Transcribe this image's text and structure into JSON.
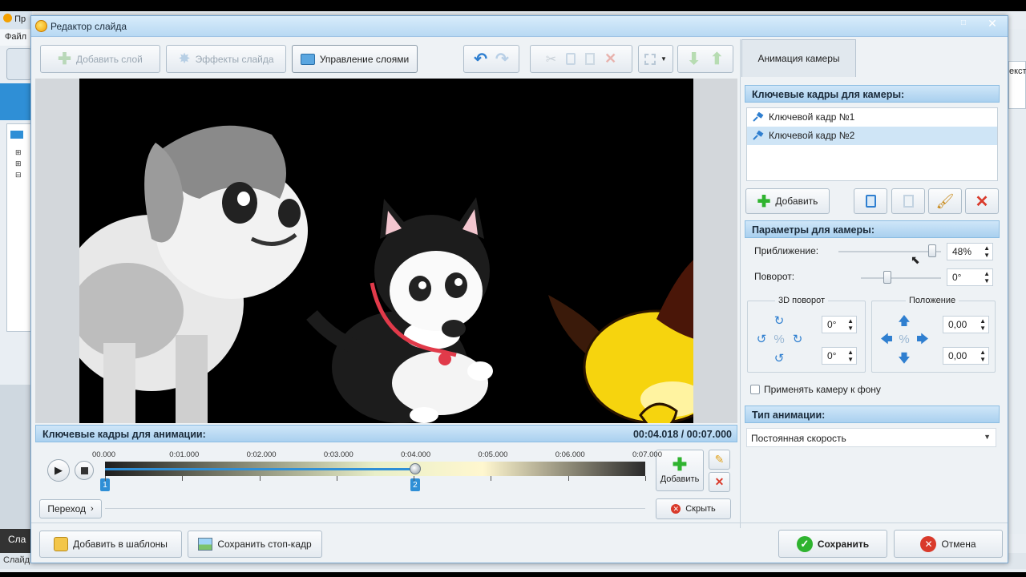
{
  "background_app": {
    "title_fragment": "Пр",
    "menu_fragment": "Файл",
    "left_bottom_fragment": "Сла",
    "status_fragment": "Слайд",
    "right_fragment": "екста"
  },
  "dialog": {
    "title": "Редактор слайда"
  },
  "toolbar": {
    "add_layer": "Добавить слой",
    "slide_effects": "Эффекты слайда",
    "manage_layers": "Управление слоями"
  },
  "timeline": {
    "header": "Ключевые кадры для анимации:",
    "time_display": "00:04.018 / 00:07.000",
    "ticks": [
      "00.000",
      "0:01.000",
      "0:02.000",
      "0:03.000",
      "0:04.000",
      "0:05.000",
      "0:06.000",
      "0:07.000"
    ],
    "markers": [
      "1",
      "2"
    ],
    "current_position_fraction": 0.574,
    "add_label": "Добавить",
    "transition_label": "Переход",
    "hide_label": "Скрыть"
  },
  "right_panel": {
    "tab": "Анимация камеры",
    "keyframes_header": "Ключевые кадры для камеры:",
    "keyframes": [
      {
        "label": "Ключевой кадр №1",
        "selected": false
      },
      {
        "label": "Ключевой кадр №2",
        "selected": true
      }
    ],
    "add_button": "Добавить",
    "params_header": "Параметры для камеры:",
    "zoom_label": "Приближение:",
    "zoom_value": "48%",
    "zoom_fraction": 0.48,
    "rotation_label": "Поворот:",
    "rotation_value": "0°",
    "rotate3d_caption": "3D поворот",
    "rotate3d_values": [
      "0°",
      "0°"
    ],
    "position_caption": "Положение",
    "position_values": [
      "0,00",
      "0,00"
    ],
    "apply_bg_label": "Применять камеру к фону",
    "anim_type_header": "Тип анимации:",
    "anim_type_value": "Постоянная скорость"
  },
  "footer": {
    "add_templates": "Добавить в шаблоны",
    "save_frame": "Сохранить стоп-кадр",
    "save": "Сохранить",
    "cancel": "Отмена"
  },
  "colors": {
    "accent": "#2f8fd6",
    "panel_head": "#a9d0ef",
    "ok_green": "#2fb32f",
    "cancel_red": "#d93a2b"
  }
}
